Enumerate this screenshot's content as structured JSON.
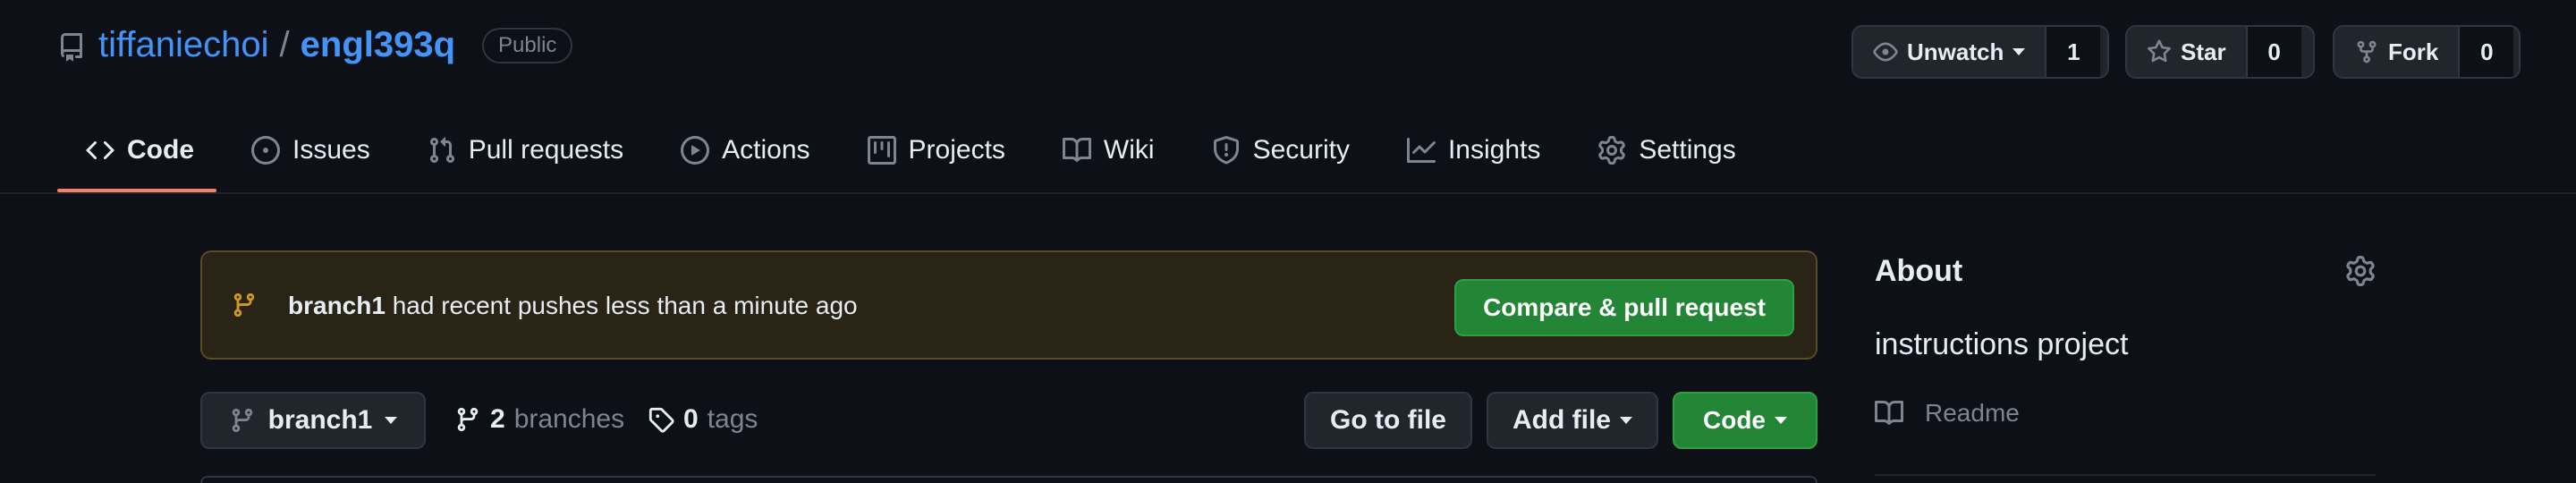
{
  "repo": {
    "owner": "tiffaniechoi",
    "separator": "/",
    "name": "engl393q",
    "visibility": "Public"
  },
  "actions": {
    "watch_label": "Unwatch",
    "watch_count": "1",
    "star_label": "Star",
    "star_count": "0",
    "fork_label": "Fork",
    "fork_count": "0"
  },
  "tabs": [
    {
      "label": "Code",
      "icon": "code-icon",
      "active": true
    },
    {
      "label": "Issues",
      "icon": "issue-icon"
    },
    {
      "label": "Pull requests",
      "icon": "pull-request-icon"
    },
    {
      "label": "Actions",
      "icon": "play-icon"
    },
    {
      "label": "Projects",
      "icon": "project-icon"
    },
    {
      "label": "Wiki",
      "icon": "book-icon"
    },
    {
      "label": "Security",
      "icon": "shield-icon"
    },
    {
      "label": "Insights",
      "icon": "graph-icon"
    },
    {
      "label": "Settings",
      "icon": "gear-icon"
    }
  ],
  "banner": {
    "branch": "branch1",
    "message": "had recent pushes less than a minute ago",
    "button": "Compare & pull request"
  },
  "branchbar": {
    "current_branch": "branch1",
    "branches_count": "2",
    "branches_label": "branches",
    "tags_count": "0",
    "tags_label": "tags",
    "goto_file": "Go to file",
    "add_file": "Add file",
    "code": "Code"
  },
  "about": {
    "title": "About",
    "description": "instructions project",
    "readme": "Readme"
  },
  "colors": {
    "background": "#0d1117",
    "link": "#4493f8",
    "accent_underline": "#f78166",
    "green_button": "#238636",
    "banner_icon": "#d29922"
  }
}
